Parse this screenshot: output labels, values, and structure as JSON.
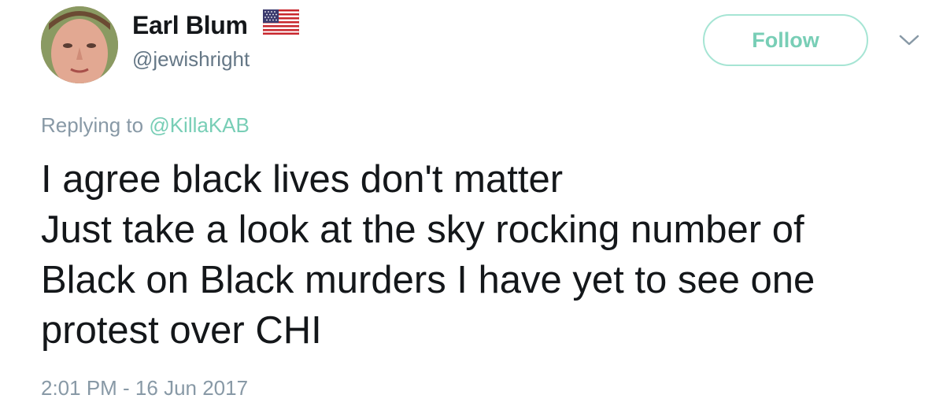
{
  "author": {
    "display_name": "Earl Blum",
    "handle": "@jewishright",
    "flag_icon": "us-flag-icon"
  },
  "actions": {
    "follow_label": "Follow",
    "more_icon": "chevron-down-icon"
  },
  "reply": {
    "prefix": "Replying to",
    "target": "@KillaKAB"
  },
  "tweet": {
    "lines": [
      "I agree black lives don't matter",
      "Just take a look at the sky rocking number of",
      "Black on Black murders I have yet to see one",
      "protest over CHI"
    ],
    "timestamp": "2:01 PM - 16 Jun 2017"
  },
  "colors": {
    "accent": "#78ceb6",
    "follow_border": "#a6e5d4",
    "secondary_text": "#657786",
    "meta_text": "#8899a6",
    "primary_text": "#14171a"
  }
}
